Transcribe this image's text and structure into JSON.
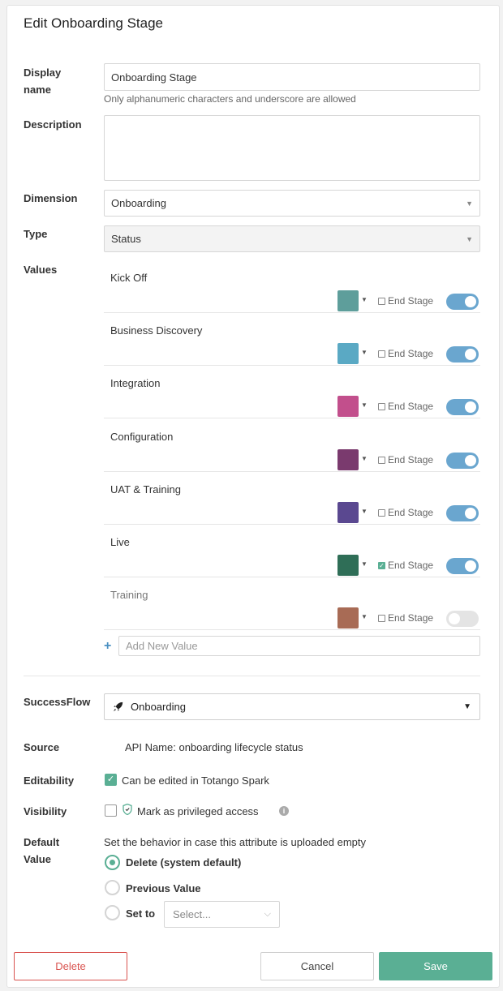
{
  "header": {
    "title": "Edit Onboarding Stage"
  },
  "display_name": {
    "label": "Display name",
    "value": "Onboarding Stage",
    "hint": "Only alphanumeric characters and underscore are allowed"
  },
  "description": {
    "label": "Description",
    "value": ""
  },
  "dimension": {
    "label": "Dimension",
    "value": "Onboarding"
  },
  "type": {
    "label": "Type",
    "value": "Status"
  },
  "values": {
    "label": "Values",
    "end_stage_label": "End Stage",
    "items": [
      {
        "name": "Kick Off",
        "color": "#5e9e9b",
        "end_stage": false,
        "enabled": true
      },
      {
        "name": "Business Discovery",
        "color": "#5aa9c4",
        "end_stage": false,
        "enabled": true
      },
      {
        "name": "Integration",
        "color": "#c24f8c",
        "end_stage": false,
        "enabled": true
      },
      {
        "name": "Configuration",
        "color": "#7a3a6e",
        "end_stage": false,
        "enabled": true
      },
      {
        "name": "UAT & Training",
        "color": "#5a4890",
        "end_stage": false,
        "enabled": true
      },
      {
        "name": "Live",
        "color": "#2f6e57",
        "end_stage": true,
        "enabled": true
      },
      {
        "name": "Training",
        "color": "#a86b55",
        "end_stage": false,
        "enabled": false
      }
    ],
    "add_placeholder": "Add New Value"
  },
  "successflow": {
    "label": "SuccessFlow",
    "value": "Onboarding"
  },
  "source": {
    "label": "Source",
    "value": "API Name: onboarding lifecycle status"
  },
  "editability": {
    "label": "Editability",
    "text": "Can be edited in Totango Spark",
    "checked": true
  },
  "visibility": {
    "label": "Visibility",
    "text": "Mark as privileged access",
    "checked": false
  },
  "default_value": {
    "label": "Default Value",
    "description": "Set the behavior in case this attribute is uploaded empty",
    "options": [
      "Delete (system default)",
      "Previous Value",
      "Set to"
    ],
    "selected": 0,
    "set_to_placeholder": "Select..."
  },
  "footer": {
    "delete_label": "Delete",
    "cancel_label": "Cancel",
    "save_label": "Save"
  },
  "colors": {
    "accent": "#5aaf94",
    "danger": "#d9534f",
    "toggle_on": "#6aa6cf"
  }
}
